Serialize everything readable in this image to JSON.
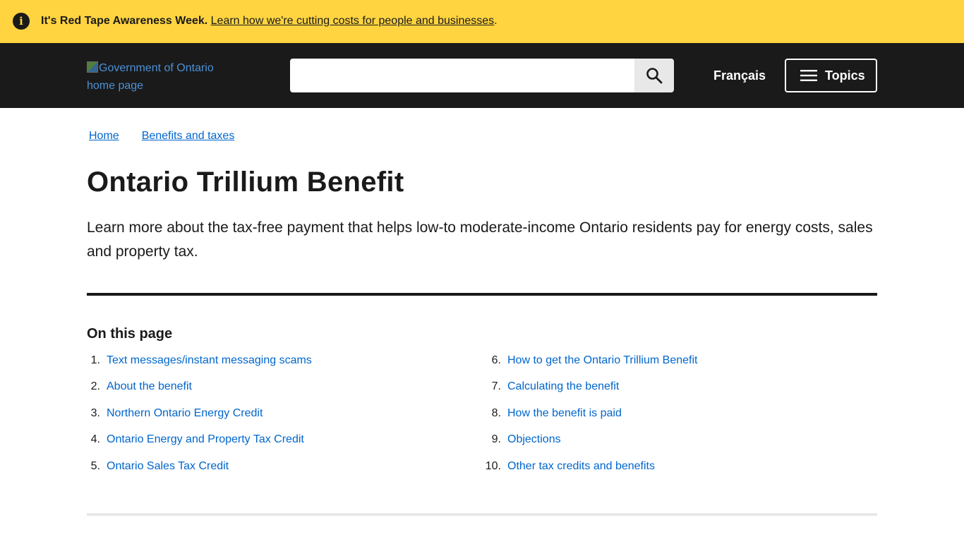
{
  "alert": {
    "icon": "info-icon",
    "bold_text": "It's Red Tape Awareness Week.",
    "link_text": "Learn how we're cutting costs for people and businesses",
    "trailing_text": ".",
    "background": "#ffd440"
  },
  "header": {
    "logo_alt": "Government of Ontario home page",
    "search": {
      "value": "",
      "placeholder": "",
      "button_icon": "search-icon"
    },
    "language_label": "Français",
    "topics_label": "Topics",
    "topics_icon": "menu-icon",
    "background": "#1a1a1a"
  },
  "breadcrumb": {
    "items": [
      "Home",
      "Benefits and taxes"
    ]
  },
  "page": {
    "title": "Ontario Trillium Benefit",
    "lead": "Learn more about the tax-free payment that helps low-to moderate-income Ontario residents pay for energy costs, sales and property tax."
  },
  "on_this_page": {
    "heading": "On this page",
    "items": [
      {
        "num": "1.",
        "label": "Text messages/instant messaging scams"
      },
      {
        "num": "2.",
        "label": "About the benefit"
      },
      {
        "num": "3.",
        "label": "Northern Ontario Energy Credit"
      },
      {
        "num": "4.",
        "label": "Ontario Energy and Property Tax Credit"
      },
      {
        "num": "5.",
        "label": "Ontario Sales Tax Credit"
      },
      {
        "num": "6.",
        "label": "How to get the Ontario Trillium Benefit"
      },
      {
        "num": "7.",
        "label": "Calculating the benefit"
      },
      {
        "num": "8.",
        "label": "How the benefit is paid"
      },
      {
        "num": "9.",
        "label": "Objections"
      },
      {
        "num": "10.",
        "label": "Other tax credits and benefits"
      }
    ]
  },
  "colors": {
    "link": "#0066cc",
    "text": "#1a1a1a"
  }
}
